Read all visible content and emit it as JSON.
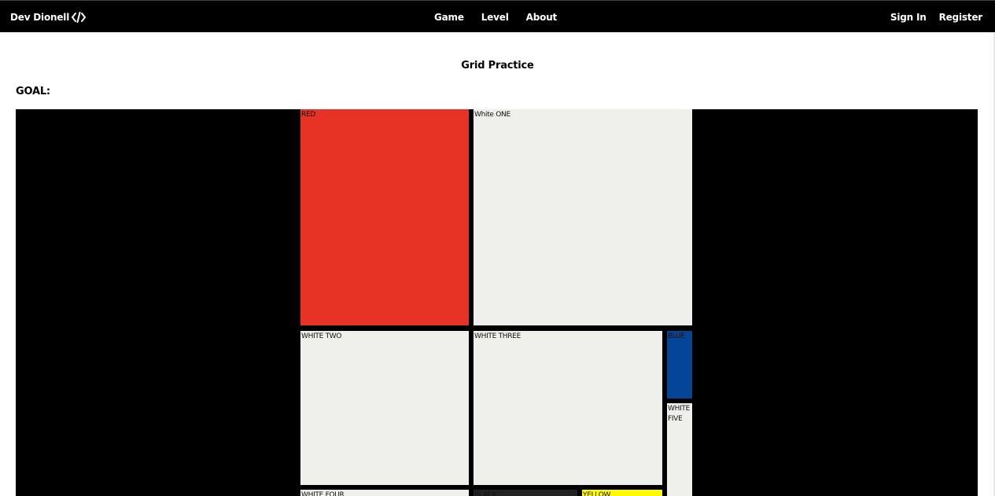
{
  "navbar": {
    "brand": "Dev Dionell",
    "brand_icon": "code-icon",
    "center_links": [
      "Game",
      "Level",
      "About"
    ],
    "right_links": [
      "Sign In",
      "Register"
    ]
  },
  "page": {
    "title": "Grid Practice",
    "goal_label": "GOAL:"
  },
  "grid": {
    "colors": {
      "background": "#000000",
      "white": "#efefeb",
      "red": "#e73325",
      "blue": "#044597",
      "yellow": "#fffa00",
      "black_cell": "#222222"
    },
    "cells": [
      {
        "label": "RED",
        "color": "red"
      },
      {
        "label": "White ONE",
        "color": "white"
      },
      {
        "label": "WHITE TWO",
        "color": "white"
      },
      {
        "label": "WHITE THREE",
        "color": "white"
      },
      {
        "label": "BLUE",
        "color": "blue"
      },
      {
        "label": "WHITE FIVE",
        "color": "white"
      },
      {
        "label": "WHITE FOUR",
        "color": "white"
      },
      {
        "label": "BLACK",
        "color": "black"
      },
      {
        "label": "YELLOW",
        "color": "yellow"
      }
    ]
  }
}
